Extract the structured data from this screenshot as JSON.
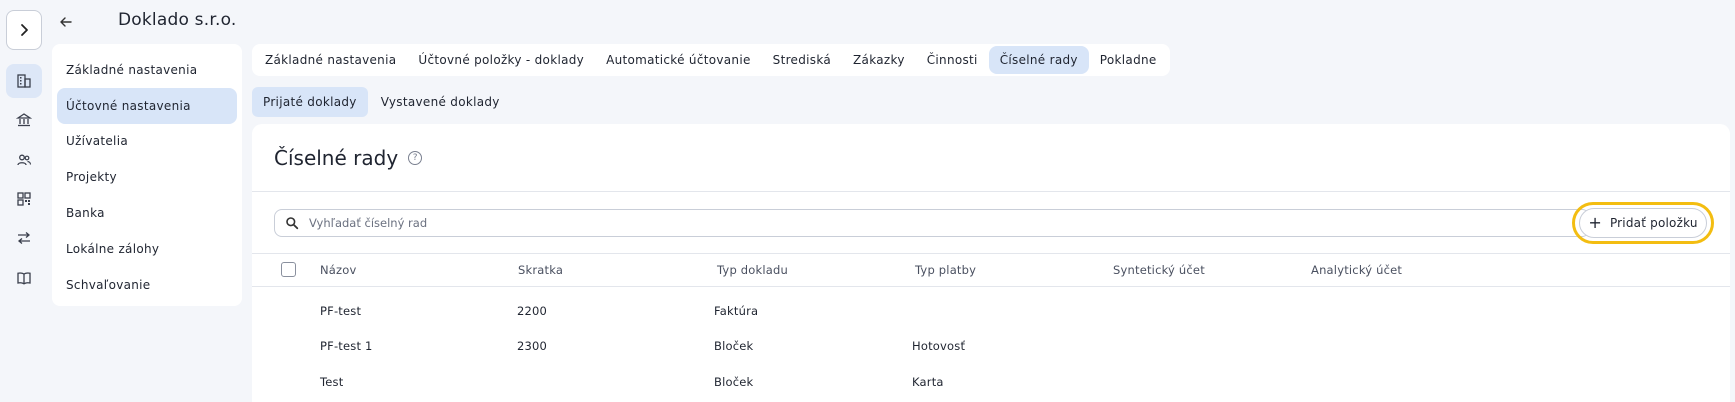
{
  "header": {
    "company_name": "Doklado s.r.o."
  },
  "rail": {
    "toggle_icon": "chevron-right-icon",
    "icons": [
      "building-icon",
      "bank-icon",
      "users-icon",
      "qr-code-icon",
      "transfer-arrows-icon",
      "book-icon"
    ]
  },
  "settings_nav": {
    "items": [
      {
        "label": "Základné nastavenia"
      },
      {
        "label": "Účtovné nastavenia"
      },
      {
        "label": "Užívatelia"
      },
      {
        "label": "Projekty"
      },
      {
        "label": "Banka"
      },
      {
        "label": "Lokálne zálohy"
      },
      {
        "label": "Schvaľovanie"
      }
    ],
    "active": "Účtovné nastavenia"
  },
  "tabs": {
    "items": [
      {
        "label": "Základné nastavenia"
      },
      {
        "label": "Účtovné položky - doklady"
      },
      {
        "label": "Automatické účtovanie"
      },
      {
        "label": "Strediská"
      },
      {
        "label": "Zákazky"
      },
      {
        "label": "Činnosti"
      },
      {
        "label": "Číselné rady"
      },
      {
        "label": "Pokladne"
      }
    ],
    "active": "Číselné rady"
  },
  "subtabs": {
    "items": [
      {
        "label": "Prijaté doklady"
      },
      {
        "label": "Vystavené doklady"
      }
    ],
    "active": "Prijaté doklady"
  },
  "panel": {
    "title": "Číselné rady",
    "search_placeholder": "Vyhľadať číselný rad",
    "search_value": "",
    "add_label": "Pridať položku"
  },
  "table": {
    "columns": [
      "Názov",
      "Skratka",
      "Typ dokladu",
      "Typ platby",
      "Syntetický účet",
      "Analytický účet"
    ],
    "rows": [
      [
        "PF-test",
        "2200",
        "Faktúra",
        "",
        "",
        ""
      ],
      [
        "PF-test 1",
        "2300",
        "Bloček",
        "Hotovosť",
        "",
        ""
      ],
      [
        "Test",
        "",
        "Bloček",
        "Karta",
        "",
        ""
      ]
    ]
  },
  "colors": {
    "accent_bg": "#d8e5f8",
    "highlight": "#f3bd11",
    "page_bg": "#f4f6fa"
  }
}
